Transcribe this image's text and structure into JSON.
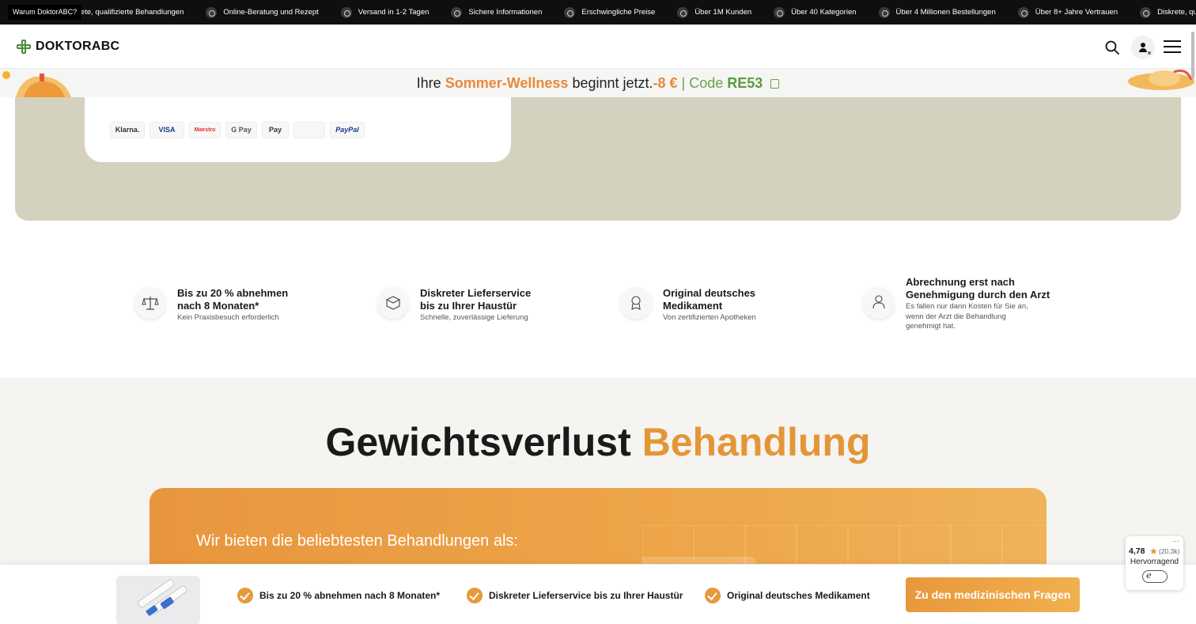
{
  "ticker": {
    "badge": "Warum DoktorABC?",
    "items": [
      "krete, qualifizierte Behandlungen",
      "Online-Beratung und Rezept",
      "Versand in 1-2 Tagen",
      "Sichere Informationen",
      "Erschwingliche Preise",
      "Über 1M Kunden",
      "Über 40 Kategorien",
      "Über 4 Millionen Bestellungen",
      "Über 8+ Jahre Vertrauen",
      "Diskrete, qualifizierte Behandlungen"
    ]
  },
  "header": {
    "logo_text": "DOKTORABC",
    "brand_color": "#4e8a3e"
  },
  "promo": {
    "lead": "Ihre ",
    "highlight": "Sommer-Wellness",
    "middle": " beginnt jetzt.",
    "discount": "-8 €",
    "separator": " | ",
    "code_label": "Code ",
    "code": "RE53"
  },
  "payments": [
    "Klarna.",
    "VISA",
    "Maestro",
    "G Pay",
    "Pay",
    "",
    "PayPal"
  ],
  "features": [
    {
      "title": "Bis zu 20 % abnehmen nach 8 Monaten*",
      "subtitle": "Kein Praxisbesuch erforderlich",
      "icon": "scale-icon"
    },
    {
      "title": "Diskreter Lieferservice bis zu Ihrer Haustür",
      "subtitle": "Schnelle, zuverlässige Lieferung",
      "icon": "package-icon"
    },
    {
      "title": "Original deutsches Medikament",
      "subtitle": "Von zertifizierten Apotheken",
      "icon": "award-icon"
    },
    {
      "title": "Abrechnung erst nach Genehmigung durch den Arzt",
      "subtitle": "Es fallen nur dann Kosten für Sie an, wenn der Arzt die Behandlung genehmigt hat.",
      "icon": "doctor-icon"
    }
  ],
  "treatment": {
    "title_main": "Gewichtsverlust",
    "title_highlight": "Behandlung",
    "card_heading": "Wir bieten die beliebtesten Behandlungen als:"
  },
  "sticky": {
    "checks": [
      "Bis zu 20 % abnehmen nach 8 Monaten*",
      "Diskreter Lieferservice bis zu Ihrer Haustür",
      "Original deutsches Medikament"
    ],
    "cta": "Zu den medizinischen Fragen"
  },
  "rating": {
    "score": "4,78",
    "count": "(20,3k)",
    "label": "Hervorragend",
    "menu": "···"
  },
  "colors": {
    "accent": "#e39638",
    "hero_bg": "#d5d1bf",
    "green": "#6aa34b"
  }
}
